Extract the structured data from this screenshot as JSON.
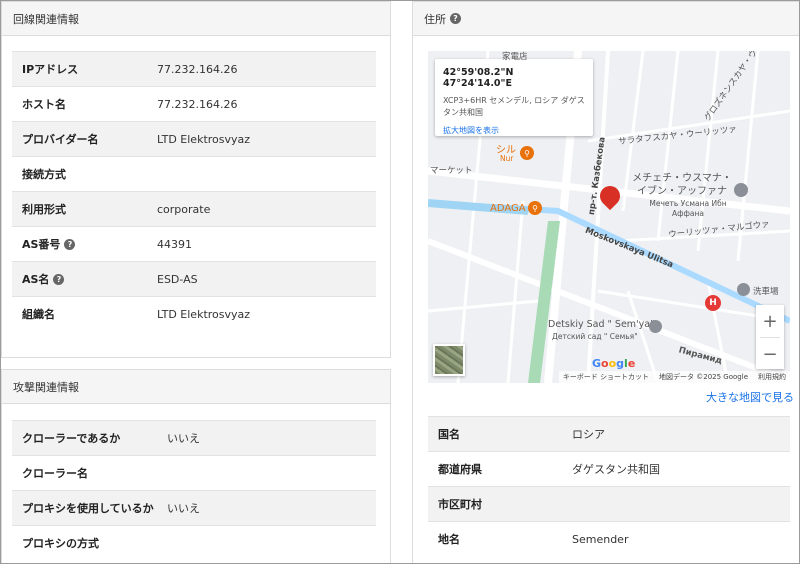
{
  "network_section": {
    "title": "回線関連情報",
    "rows": [
      {
        "key": "IPアドレス",
        "value": "77.232.164.26"
      },
      {
        "key": "ホスト名",
        "value": "77.232.164.26"
      },
      {
        "key": "プロバイダー名",
        "value": "LTD Elektrosvyaz"
      },
      {
        "key": "接続方式",
        "value": ""
      },
      {
        "key": "利用形式",
        "value": "corporate"
      },
      {
        "key": "AS番号",
        "value": "44391"
      },
      {
        "key": "AS名",
        "value": "ESD-AS"
      },
      {
        "key": "組織名",
        "value": "LTD Elektrosvyaz"
      }
    ]
  },
  "attack_section": {
    "title": "攻撃関連情報",
    "rows": [
      {
        "key": "クローラーであるか",
        "value": "いいえ"
      },
      {
        "key": "クローラー名",
        "value": ""
      },
      {
        "key": "プロキシを使用しているか",
        "value": "いいえ"
      },
      {
        "key": "プロキシの方式",
        "value": ""
      }
    ]
  },
  "address_section": {
    "title": "住所",
    "map": {
      "coordinates": "42°59'08.2\"N 47°24'14.0\"E",
      "address": "XCP3+6HR セメンデル, ロシア ダゲスタン共和国",
      "enlarge_link": "拡大地図を表示",
      "labels": {
        "kaden": "家電店",
        "shiru": "シル",
        "nur": "Nur",
        "market": "マーケット",
        "adaga": "ADAGA",
        "street_top": "サラタフスカヤ・ウーリッツァ",
        "street_r1": "グロズネンスカヤ・ウ",
        "mosque_jp": "メチェチ・ウスマナ・イブン・アッファナ",
        "mosque_ru": "Мечеть Усмана Ибн Аффана",
        "street_maru": "ウーリッツァ・マルゴウァ",
        "moscow": "Moskovskaya Ulitsa",
        "kazbekova": "пр-т. Казбекова",
        "laundry": "洗車場",
        "detsky": "Detskiy Sad \" Sem'ya\"",
        "detsky_ru": "Детский сад \" Семья\"",
        "piramid": "Пирамид",
        "google": "Google"
      },
      "attribution": [
        "キーボード ショートカット",
        "地図データ ©2025 Google",
        "利用規約"
      ],
      "zoom_in": "+",
      "zoom_out": "−"
    },
    "bigger_map_link": "大きな地図で見る",
    "rows": [
      {
        "key": "国名",
        "value": "ロシア"
      },
      {
        "key": "都道府県",
        "value": "ダゲスタン共和国"
      },
      {
        "key": "市区町村",
        "value": ""
      },
      {
        "key": "地名",
        "value": "Semender"
      }
    ]
  },
  "colors": {
    "accent_link": "#1a73e8",
    "header_bg": "#f5f5f5",
    "stripe": "#f2f2f2",
    "pin": "#d93025"
  }
}
